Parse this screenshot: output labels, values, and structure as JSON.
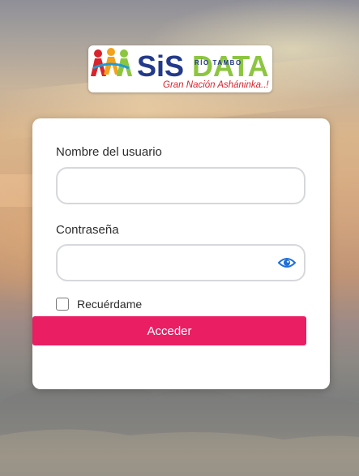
{
  "logo": {
    "name_part1": "SiS",
    "name_part2": "DATA",
    "subtitle": "RÍO TAMBO",
    "tagline": "Gran Nación Asháninka..!"
  },
  "login_form": {
    "username_label": "Nombre del usuario",
    "username_value": "",
    "username_placeholder": "",
    "password_label": "Contraseña",
    "password_value": "",
    "password_placeholder": "",
    "remember_label": "Recuérdame",
    "remember_checked": false,
    "submit_label": "Acceder"
  },
  "icons": {
    "password_toggle": "eye-icon",
    "logo_figures": "people-icon"
  },
  "colors": {
    "primary_button": "#e91e63",
    "eye_icon": "#1e6fd9",
    "logo_red": "#d9232d",
    "logo_navy": "#233a8b",
    "logo_green": "#8cc63f"
  }
}
